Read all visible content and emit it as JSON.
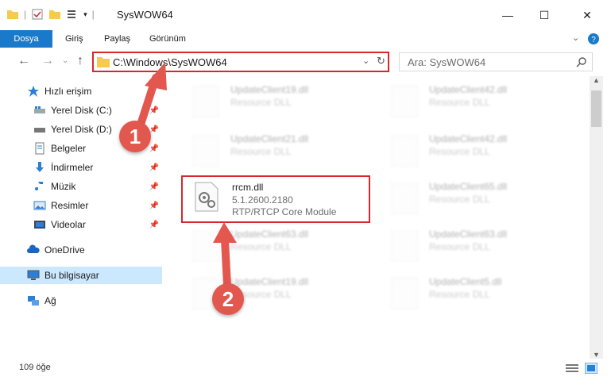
{
  "window": {
    "title": "SysWOW64",
    "minimize": "—",
    "maximize": "☐",
    "close": "✕"
  },
  "ribbon": {
    "tabs": [
      "Dosya",
      "Giriş",
      "Paylaş",
      "Görünüm"
    ]
  },
  "address": {
    "path": "C:\\Windows\\SysWOW64",
    "search_placeholder": "Ara: SysWOW64"
  },
  "sidebar": {
    "items": [
      {
        "label": "Hızlı erişim",
        "icon": "star-icon"
      },
      {
        "label": "Yerel Disk (C:)",
        "icon": "drive-icon"
      },
      {
        "label": "Yerel Disk (D:)",
        "icon": "drive-icon"
      },
      {
        "label": "Belgeler",
        "icon": "documents-icon"
      },
      {
        "label": "İndirmeler",
        "icon": "download-icon"
      },
      {
        "label": "Müzik",
        "icon": "music-icon"
      },
      {
        "label": "Resimler",
        "icon": "pictures-icon"
      },
      {
        "label": "Videolar",
        "icon": "videos-icon"
      },
      {
        "label": "OneDrive",
        "icon": "cloud-icon"
      },
      {
        "label": "Bu bilgisayar",
        "icon": "computer-icon"
      },
      {
        "label": "Ağ",
        "icon": "network-icon"
      }
    ]
  },
  "files": [
    {
      "name": "UpdateClient19.dll",
      "line2": "Resource DLL"
    },
    {
      "name": "UpdateClient42.dll",
      "line2": "Resource DLL"
    },
    {
      "name": "UpdateClient21.dll",
      "line2": "Resource DLL"
    },
    {
      "name": "UpdateClient42.dll",
      "line2": "Resource DLL"
    },
    {
      "name": "rrcm.dll",
      "line2": "5.1.2600.2180",
      "line3": "RTP/RTCP Core Module"
    },
    {
      "name": "UpdateClient65.dll",
      "line2": "Resource DLL"
    },
    {
      "name": "UpdateClient63.dll",
      "line2": "Resource DLL"
    },
    {
      "name": "UpdateClient63.dll",
      "line2": "Resource DLL"
    },
    {
      "name": "UpdateClient19.dll",
      "line2": "Resource DLL"
    },
    {
      "name": "UpdateClient5.dll",
      "line2": "Resource DLL"
    }
  ],
  "status": {
    "count": "109 öğe"
  },
  "steps": [
    "1",
    "2"
  ],
  "colors": {
    "accent": "#1979ca",
    "highlight": "#d9262c",
    "step": "#e2584f"
  }
}
